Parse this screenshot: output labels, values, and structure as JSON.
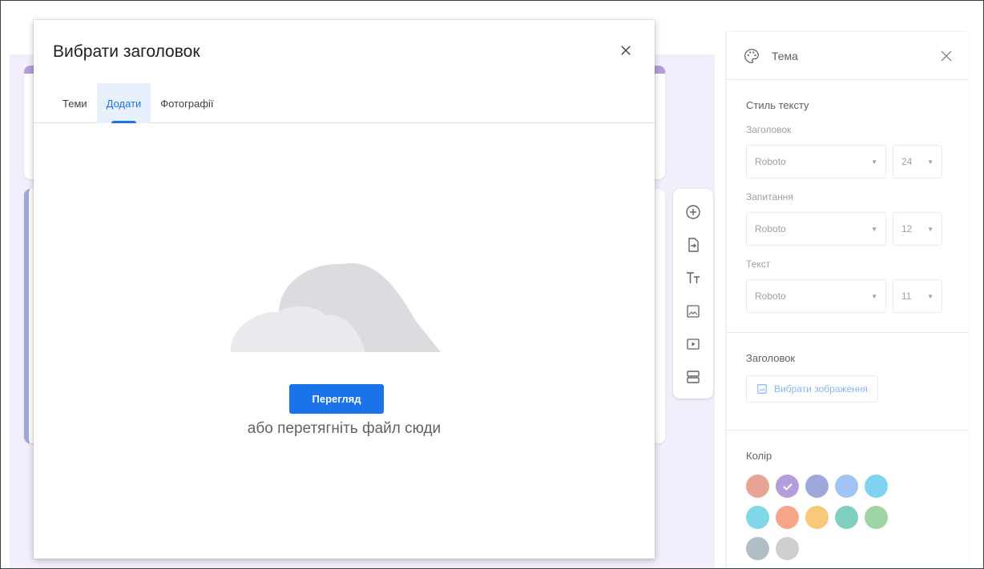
{
  "dialog": {
    "title": "Вибрати заголовок",
    "tabs": [
      {
        "label": "Теми",
        "active": false
      },
      {
        "label": "Додати",
        "active": true
      },
      {
        "label": "Фотографії",
        "active": false
      }
    ],
    "browse_label": "Перегляд",
    "drag_text": "або перетягніть файл сюди",
    "icons": {
      "close": "close-icon",
      "illustration": "cloud-icon"
    }
  },
  "toolbar": {
    "icons": [
      "add-question-icon",
      "import-questions-icon",
      "title-text-icon",
      "image-icon",
      "video-icon",
      "section-icon"
    ]
  },
  "panel": {
    "title": "Тема",
    "text_style": {
      "title": "Стиль тексту",
      "heading": {
        "label": "Заголовок",
        "font": "Roboto",
        "size": "24"
      },
      "question": {
        "label": "Запитання",
        "font": "Roboto",
        "size": "12"
      },
      "text": {
        "label": "Текст",
        "font": "Roboto",
        "size": "11"
      }
    },
    "header": {
      "title": "Заголовок",
      "button_label": "Вибрати зображення"
    },
    "color": {
      "title": "Колір",
      "swatches": [
        "#e8a595",
        "#b39ddb",
        "#9fa8da",
        "#a0c4f5",
        "#7fd3f0",
        "#80d8e6",
        "#f7a68a",
        "#f9c97a",
        "#7fcfc0",
        "#9ed5a4",
        "#b0bec5",
        "#cfcfcf"
      ],
      "selected_index": 1
    }
  },
  "colors": {
    "accent": "#1a73e8",
    "tab_active_bg": "#e8f0fe",
    "form_bg": "#f2eefb"
  }
}
